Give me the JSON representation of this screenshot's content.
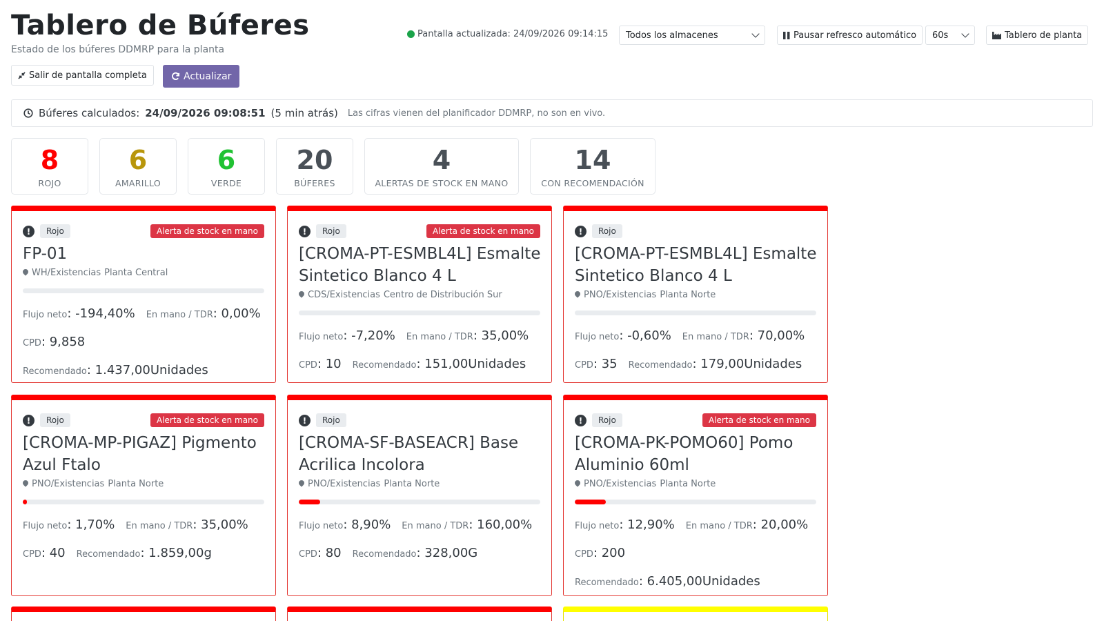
{
  "header": {
    "title": "Tablero de Búferes",
    "subtitle": "Estado de los búferes DDMRP para la planta",
    "exit_fullscreen_label": "Salir de pantalla completa",
    "refresh_label": "Actualizar",
    "updated_text": "Pantalla actualizada: 24/09/2026 09:14:15",
    "warehouse_select": "Todos los almacenes",
    "pause_label": "Pausar refresco automático",
    "interval_select": "60s",
    "plant_board_label": "Tablero de planta",
    "colors": {
      "accent": "#7266a9",
      "status_dot": "#1ba34a"
    }
  },
  "calc": {
    "label": "Búferes calculados:",
    "value": "24/09/2026 09:08:51",
    "ago": "(5 min atrás)",
    "note": "Las cifras vienen del planificador DDMRP, no son en vivo."
  },
  "stats": [
    {
      "value": "8",
      "label": "ROJO",
      "color": "#ff0000"
    },
    {
      "value": "6",
      "label": "AMARILLO",
      "color": "#b8960c"
    },
    {
      "value": "6",
      "label": "VERDE",
      "color": "#21c233"
    },
    {
      "value": "20",
      "label": "BÚFERES",
      "color": "#495057"
    },
    {
      "value": "4",
      "label": "ALERTAS DE STOCK EN MANO",
      "color": "#495057"
    },
    {
      "value": "14",
      "label": "CON RECOMENDACIÓN",
      "color": "#495057"
    }
  ],
  "labels": {
    "net_flow": "Flujo neto",
    "on_hand": "En mano / TDR",
    "adu": "CPD",
    "recommended": "Recomendado",
    "stock_alert": "Alerta de stock en mano"
  },
  "cards": [
    {
      "zone": "Rojo",
      "stock_alert": true,
      "title": "FP-01",
      "location": "WH/Existencias",
      "warehouse": "Planta Central",
      "fill_pct": 0,
      "net_flow": "-194,40%",
      "on_hand": "0,00%",
      "adu": "9,858",
      "recommended": "1.437,00Unidades"
    },
    {
      "zone": "Rojo",
      "stock_alert": true,
      "title": "[CROMA-PT-ESMBL4L] Esmalte Sintetico Blanco 4 L",
      "location": "CDS/Existencias",
      "warehouse": "Centro de Distribución Sur",
      "fill_pct": 0,
      "net_flow": "-7,20%",
      "on_hand": "35,00%",
      "adu": "10",
      "recommended": "151,00Unidades"
    },
    {
      "zone": "Rojo",
      "stock_alert": false,
      "title": "[CROMA-PT-ESMBL4L] Esmalte Sintetico Blanco 4 L",
      "location": "PNO/Existencias",
      "warehouse": "Planta Norte",
      "fill_pct": 0,
      "net_flow": "-0,60%",
      "on_hand": "70,00%",
      "adu": "35",
      "recommended": "179,00Unidades"
    },
    {
      "zone": "Rojo",
      "stock_alert": true,
      "title": "[CROMA-MP-PIGAZ] Pigmento Azul Ftalo",
      "location": "PNO/Existencias",
      "warehouse": "Planta Norte",
      "fill_pct": 1.7,
      "net_flow": "1,70%",
      "on_hand": "35,00%",
      "adu": "40",
      "recommended": "1.859,00g"
    },
    {
      "zone": "Rojo",
      "stock_alert": false,
      "title": "[CROMA-SF-BASEACR] Base Acrilica Incolora",
      "location": "PNO/Existencias",
      "warehouse": "Planta Norte",
      "fill_pct": 8.9,
      "net_flow": "8,90%",
      "on_hand": "160,00%",
      "adu": "80",
      "recommended": "328,00G"
    },
    {
      "zone": "Rojo",
      "stock_alert": true,
      "title": "[CROMA-PK-POMO60] Pomo Aluminio 60ml",
      "location": "PNO/Existencias",
      "warehouse": "Planta Norte",
      "fill_pct": 12.9,
      "net_flow": "12,90%",
      "on_hand": "20,00%",
      "adu": "200",
      "recommended": "6.405,00Unidades"
    }
  ]
}
